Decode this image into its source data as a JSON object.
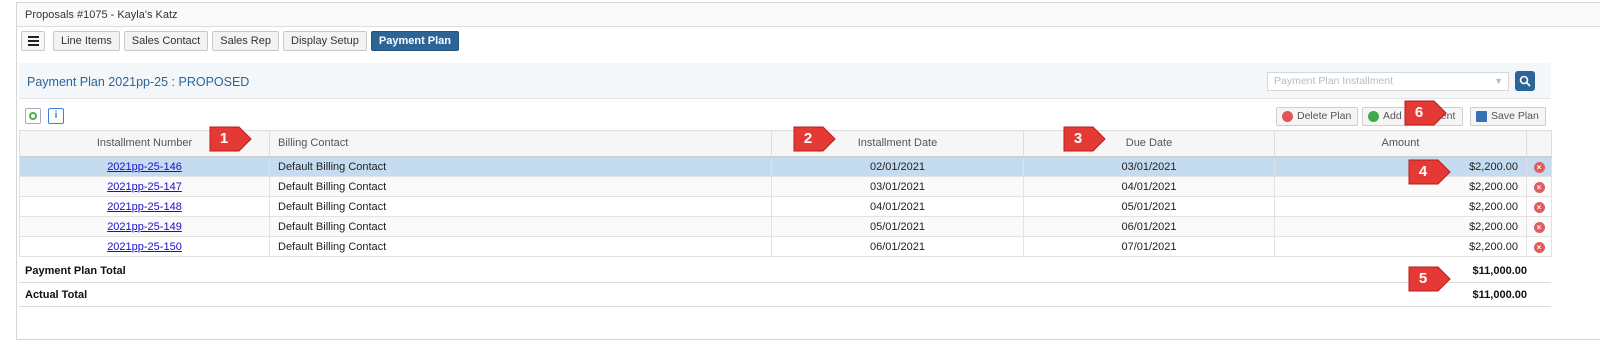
{
  "window": {
    "title": "Proposals #1075 - Kayla's Katz"
  },
  "tabs": [
    {
      "label": "Line Items"
    },
    {
      "label": "Sales Contact"
    },
    {
      "label": "Sales Rep"
    },
    {
      "label": "Display Setup"
    },
    {
      "label": "Payment Plan",
      "active": true
    }
  ],
  "panel": {
    "title": "Payment Plan 2021pp-25 : PROPOSED",
    "select_placeholder": "Payment Plan Installment"
  },
  "toolbar": {
    "delete_label": "Delete Plan",
    "add_label": "Add Installment",
    "save_label": "Save Plan"
  },
  "table": {
    "columns": [
      "Installment Number",
      "Billing Contact",
      "Installment Date",
      "Due Date",
      "Amount"
    ],
    "rows": [
      {
        "number": "2021pp-25-146",
        "contact": "Default Billing Contact",
        "installment_date": "02/01/2021",
        "due_date": "03/01/2021",
        "amount": "$2,200.00"
      },
      {
        "number": "2021pp-25-147",
        "contact": "Default Billing Contact",
        "installment_date": "03/01/2021",
        "due_date": "04/01/2021",
        "amount": "$2,200.00"
      },
      {
        "number": "2021pp-25-148",
        "contact": "Default Billing Contact",
        "installment_date": "04/01/2021",
        "due_date": "05/01/2021",
        "amount": "$2,200.00"
      },
      {
        "number": "2021pp-25-149",
        "contact": "Default Billing Contact",
        "installment_date": "05/01/2021",
        "due_date": "06/01/2021",
        "amount": "$2,200.00"
      },
      {
        "number": "2021pp-25-150",
        "contact": "Default Billing Contact",
        "installment_date": "06/01/2021",
        "due_date": "07/01/2021",
        "amount": "$2,200.00"
      }
    ]
  },
  "totals": {
    "plan_label": "Payment Plan Total",
    "plan_value": "$11,000.00",
    "actual_label": "Actual Total",
    "actual_value": "$11,000.00"
  },
  "callouts": [
    "1",
    "2",
    "3",
    "4",
    "5",
    "6"
  ],
  "colors": {
    "accent": "#2d6496",
    "selected_row": "#c5dcf0",
    "callout": "#e53935"
  }
}
